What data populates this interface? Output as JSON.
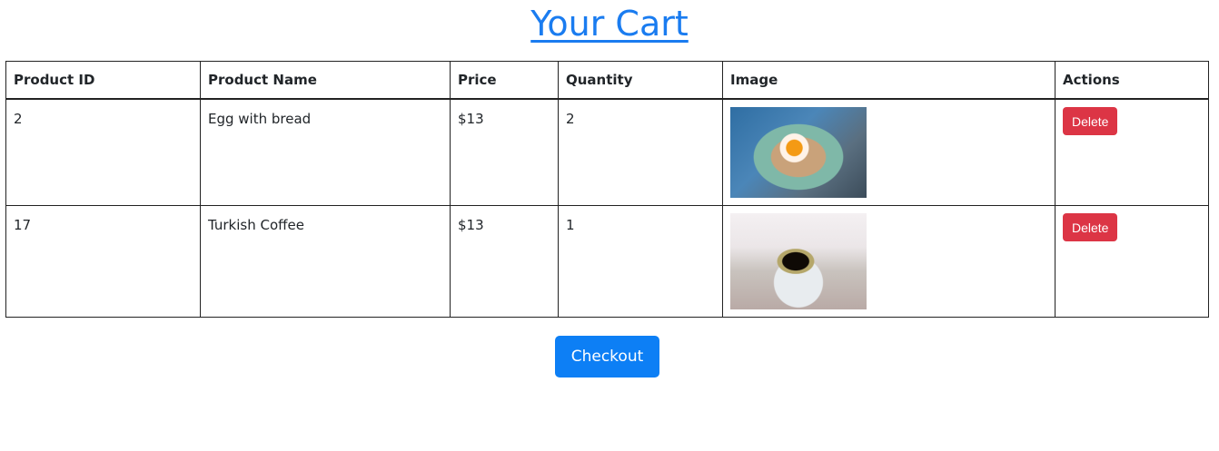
{
  "page": {
    "title": "Your Cart"
  },
  "table": {
    "headers": [
      "Product ID",
      "Product Name",
      "Price",
      "Quantity",
      "Image",
      "Actions"
    ],
    "rows": [
      {
        "id": "2",
        "name": "Egg with bread",
        "price": "$13",
        "quantity": "2",
        "image": "egg-with-bread-photo",
        "action": "Delete"
      },
      {
        "id": "17",
        "name": "Turkish Coffee",
        "price": "$13",
        "quantity": "1",
        "image": "turkish-coffee-photo",
        "action": "Delete"
      }
    ]
  },
  "checkout_label": "Checkout",
  "colors": {
    "title_link": "#1a7cf0",
    "delete": "#dc3545",
    "checkout": "#0d7ff5"
  }
}
